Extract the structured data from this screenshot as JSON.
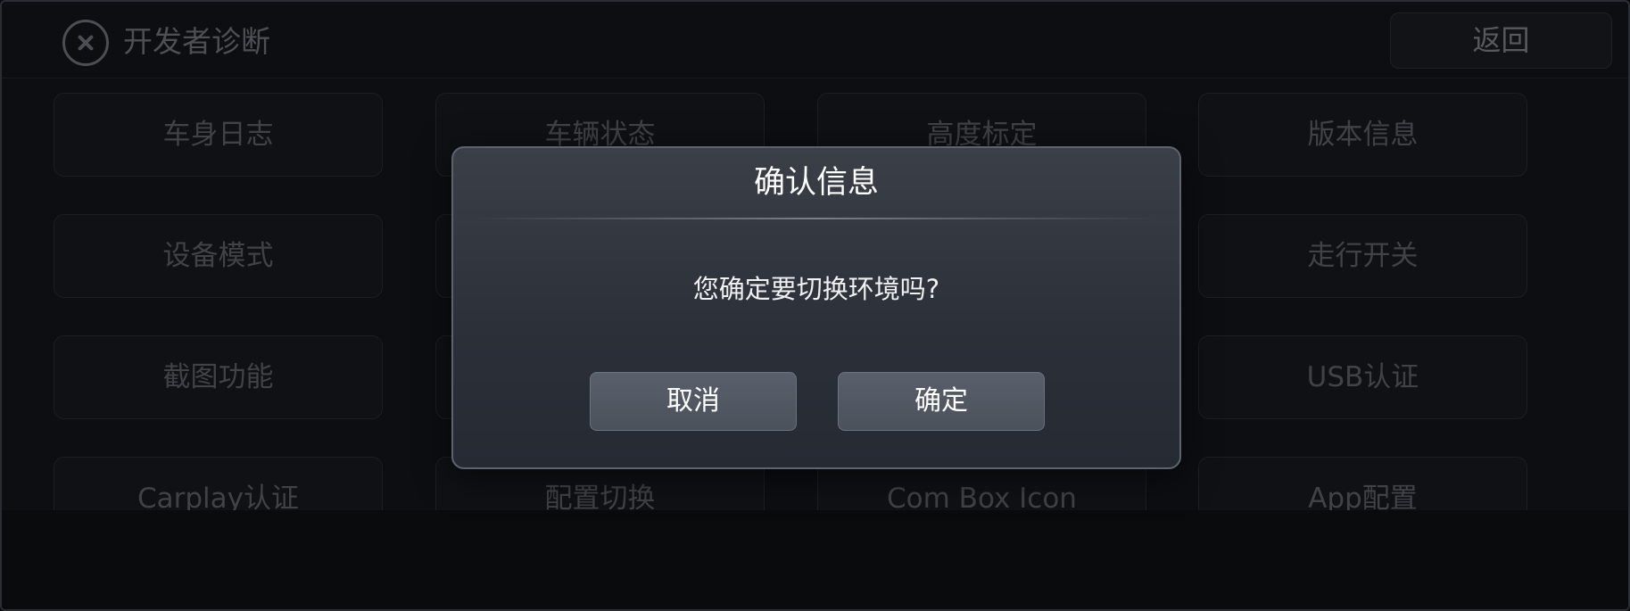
{
  "header": {
    "title": "开发者诊断",
    "back_label": "返回",
    "close_icon": "close-circle-icon"
  },
  "grid": {
    "tiles": [
      "车身日志",
      "车辆状态",
      "高度标定",
      "版本信息",
      "设备模式",
      "",
      "",
      "走行开关",
      "截图功能",
      "",
      "",
      "USB认证",
      "Carplay认证",
      "配置切换",
      "Com Box Icon",
      "App配置"
    ]
  },
  "dialog": {
    "title": "确认信息",
    "message": "您确定要切换环境吗?",
    "cancel_label": "取消",
    "confirm_label": "确定"
  },
  "colors": {
    "background": "#101216",
    "dialog_bg": "#2f333c",
    "dialog_border": "#5d6470",
    "button_bg": "#525862",
    "text_primary": "#ffffff",
    "text_dim": "#4e5157"
  }
}
